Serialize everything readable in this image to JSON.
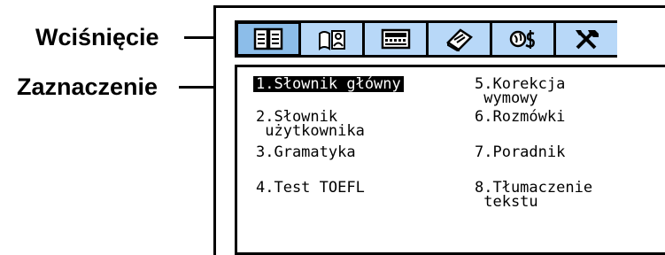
{
  "callouts": {
    "pressed": "Wciśnięcie",
    "selection": "Zaznaczenie"
  },
  "toolbar": {
    "buttons": [
      {
        "icon": "open-book-icon",
        "state": "pressed"
      },
      {
        "icon": "book-user-icon",
        "state": "normal"
      },
      {
        "icon": "keyboard-icon",
        "state": "normal"
      },
      {
        "icon": "closed-book-icon",
        "state": "normal"
      },
      {
        "icon": "globe-currency-icon",
        "state": "normal"
      },
      {
        "icon": "tools-icon",
        "state": "normal"
      }
    ]
  },
  "menu": {
    "items": [
      {
        "label": "1.Słownik główny",
        "selected": true
      },
      {
        "label": "2.Słownik\n użytkownika",
        "selected": false
      },
      {
        "label": "3.Gramatyka",
        "selected": false
      },
      {
        "label": "4.Test TOEFL",
        "selected": false
      },
      {
        "label": "5.Korekcja\n wymowy",
        "selected": false
      },
      {
        "label": "6.Rozmówki",
        "selected": false
      },
      {
        "label": "7.Poradnik",
        "selected": false
      },
      {
        "label": "8.Tłumaczenie\n tekstu",
        "selected": false
      }
    ]
  },
  "colors": {
    "button_fill": "#b8d8f8",
    "button_pressed_fill": "#8cbde9",
    "selection_bg": "#000000",
    "selection_fg": "#ffffff"
  }
}
